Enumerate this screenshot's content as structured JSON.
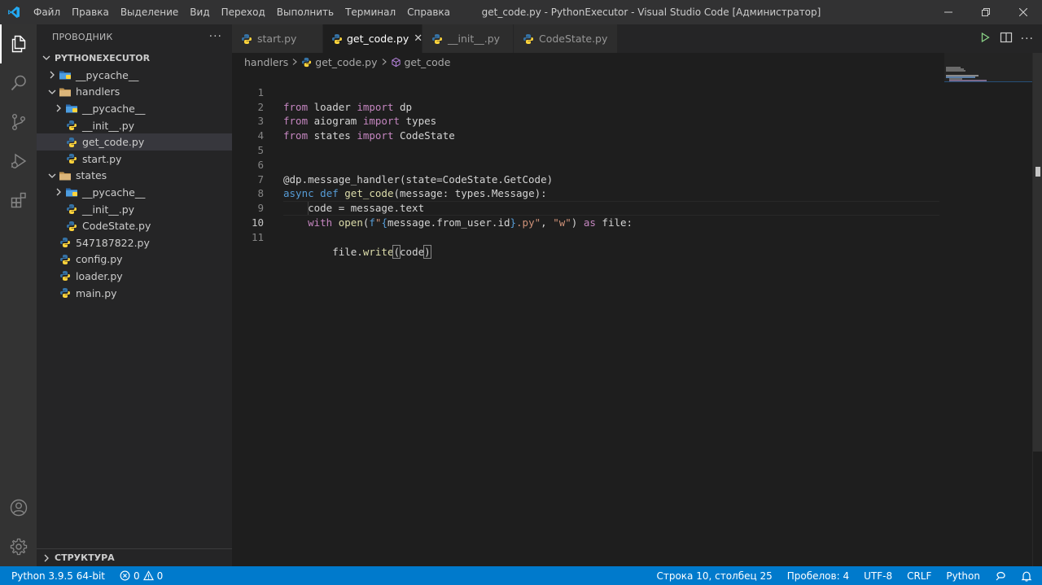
{
  "titlebar": {
    "menu": [
      "Файл",
      "Правка",
      "Выделение",
      "Вид",
      "Переход",
      "Выполнить",
      "Терминал",
      "Справка"
    ],
    "title": "get_code.py - PythonExecutor - Visual Studio Code [Администратор]"
  },
  "sidebar": {
    "header": "ПРОВОДНИК",
    "more": "···",
    "project": "PYTHONEXECUTOR",
    "tree": [
      {
        "label": "__pycache__",
        "kind": "folder-special",
        "depth": 0,
        "chevron": "right"
      },
      {
        "label": "handlers",
        "kind": "folder",
        "depth": 0,
        "chevron": "down"
      },
      {
        "label": "__pycache__",
        "kind": "folder-special",
        "depth": 1,
        "chevron": "right"
      },
      {
        "label": "__init__.py",
        "kind": "python",
        "depth": 1,
        "chevron": ""
      },
      {
        "label": "get_code.py",
        "kind": "python",
        "depth": 1,
        "chevron": "",
        "selected": true
      },
      {
        "label": "start.py",
        "kind": "python",
        "depth": 1,
        "chevron": ""
      },
      {
        "label": "states",
        "kind": "folder",
        "depth": 0,
        "chevron": "down"
      },
      {
        "label": "__pycache__",
        "kind": "folder-special",
        "depth": 1,
        "chevron": "right"
      },
      {
        "label": "__init__.py",
        "kind": "python",
        "depth": 1,
        "chevron": ""
      },
      {
        "label": "CodeState.py",
        "kind": "python",
        "depth": 1,
        "chevron": ""
      },
      {
        "label": "547187822.py",
        "kind": "python",
        "depth": 0,
        "chevron": ""
      },
      {
        "label": "config.py",
        "kind": "python",
        "depth": 0,
        "chevron": ""
      },
      {
        "label": "loader.py",
        "kind": "python",
        "depth": 0,
        "chevron": ""
      },
      {
        "label": "main.py",
        "kind": "python",
        "depth": 0,
        "chevron": ""
      }
    ],
    "outline": "СТРУКТУРА"
  },
  "tabs": [
    {
      "label": "start.py",
      "active": false
    },
    {
      "label": "get_code.py",
      "active": true,
      "close": "✕"
    },
    {
      "label": "__init__.py",
      "active": false
    },
    {
      "label": "CodeState.py",
      "active": false
    }
  ],
  "breadcrumb": {
    "folder": "handlers",
    "file": "get_code.py",
    "symbol": "get_code"
  },
  "editor": {
    "current_line": 10,
    "lines": [
      "from loader import dp",
      "from aiogram import types",
      "from states import CodeState",
      "",
      "",
      "@dp.message_handler(state=CodeState.GetCode)",
      "async def get_code(message: types.Message):",
      "    code = message.text",
      "    with open(f\"{message.from_user.id}.py\", \"w\") as file:",
      "        file.write(code)",
      ""
    ]
  },
  "statusbar": {
    "interpreter": "Python 3.9.5 64-bit",
    "errors": "0",
    "warnings": "0",
    "position": "Строка 10, столбец 25",
    "spaces": "Пробелов: 4",
    "encoding": "UTF-8",
    "eol": "CRLF",
    "language": "Python"
  },
  "colors": {
    "accent": "#007acc",
    "keyword": "#c586c0",
    "builtin_keyword": "#569cd6",
    "string": "#ce9178",
    "function": "#dcdcaa",
    "python_icon_blue": "#3572A5",
    "python_icon_yellow": "#ffd43b",
    "folder_blue": "#4d9de0"
  }
}
